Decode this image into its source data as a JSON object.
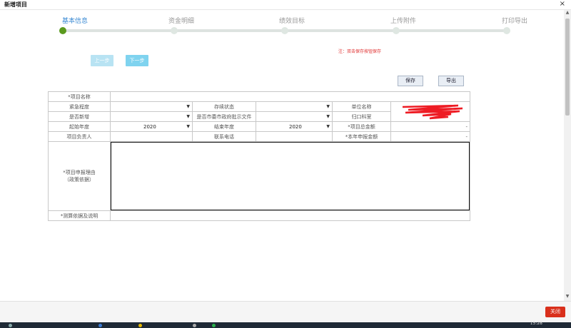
{
  "window": {
    "title": "新增项目",
    "close_glyph": "×"
  },
  "steps": [
    {
      "label": "基本信息",
      "active": true
    },
    {
      "label": "资金明细",
      "active": false
    },
    {
      "label": "绩效目标",
      "active": false
    },
    {
      "label": "上传附件",
      "active": false
    },
    {
      "label": "打印导出",
      "active": false
    }
  ],
  "nav": {
    "prev_label": "上一步",
    "next_label": "下一步"
  },
  "note": "注：双击保存按钮保存",
  "actions": {
    "save_label": "保存",
    "export_label": "导出"
  },
  "form": {
    "project_name_label": "*项目名称",
    "urgency_label": "紧急程度",
    "continuation_label": "存续状态",
    "unit_name_label": "单位名称",
    "is_new_label": "是否新增",
    "gov_doc_label": "是否市委市政府批示文件",
    "dept_label": "归口科室",
    "start_year_label": "起始年度",
    "start_year_value": "2020",
    "end_year_label": "结束年度",
    "end_year_value": "2020",
    "total_amount_label": "*项目总金额",
    "total_amount_value": "-",
    "owner_label": "项目负责人",
    "phone_label": "联系电话",
    "this_year_label": "*本年申报金额",
    "this_year_value": "-",
    "reason_label": "*项目申报理由\n（政策依据）",
    "basis_label": "*测算依据及说明"
  },
  "footer": {
    "close_label": "关闭"
  },
  "taskbar": {
    "clock": "15:28"
  },
  "colors": {
    "accent": "#3a8ad3",
    "active_dot": "#5a9a1e",
    "required": "#d01818",
    "close_button": "#d9301c"
  }
}
